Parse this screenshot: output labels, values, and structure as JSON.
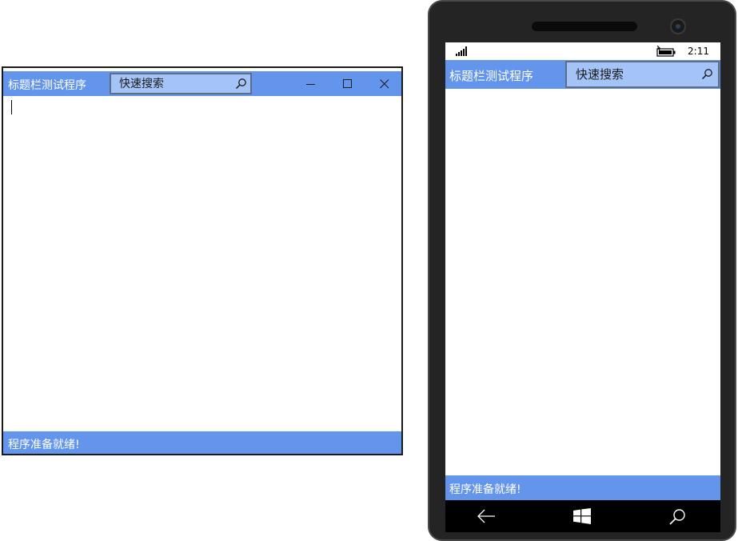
{
  "desktop": {
    "title": "标题栏测试程序",
    "search": {
      "placeholder": "快速搜索",
      "value": ""
    },
    "caption_buttons": [
      "minimize-icon",
      "maximize-icon",
      "close-icon"
    ],
    "status_text": "程序准备就绪!"
  },
  "phone": {
    "status_bar": {
      "time": "2:11",
      "icons": [
        "signal-icon",
        "battery-charging-icon"
      ]
    },
    "title": "标题栏测试程序",
    "search": {
      "placeholder": "快速搜索",
      "value": ""
    },
    "status_text": "程序准备就绪!",
    "nav_buttons": [
      "back-arrow-icon",
      "windows-start-icon",
      "search-icon"
    ]
  },
  "colors": {
    "accent": "#6495ed",
    "search_bg": "#a4c3f6",
    "search_border": "#5e6e89"
  }
}
